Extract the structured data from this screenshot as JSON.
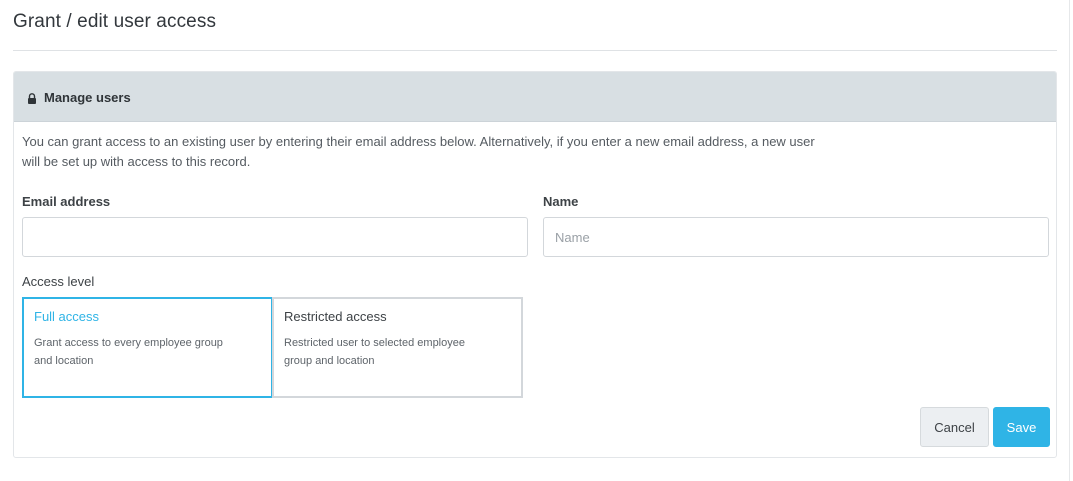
{
  "page": {
    "title": "Grant / edit user access"
  },
  "panel": {
    "header_label": "Manage users",
    "header_icon": "lock-icon",
    "intro_line1": "You can grant access to an existing user by entering their email address below. Alternatively, if you enter a new email address, a new user",
    "intro_line2": "will be set up with access to this record."
  },
  "form": {
    "email": {
      "label": "Email address",
      "value": "",
      "placeholder": ""
    },
    "name": {
      "label": "Name",
      "value": "",
      "placeholder": "Name"
    },
    "access_level": {
      "label": "Access level",
      "selected": "full",
      "options": [
        {
          "id": "full",
          "title": "Full access",
          "description_line1": "Grant access to every employee group",
          "description_line2": "and location"
        },
        {
          "id": "restricted",
          "title": "Restricted access",
          "description_line1": "Restricted user to selected employee",
          "description_line2": "group and location"
        }
      ]
    }
  },
  "actions": {
    "cancel_label": "Cancel",
    "save_label": "Save"
  },
  "colors": {
    "accent": "#2fb4e6",
    "header_bg": "#d8dfe3",
    "border": "#d3d7db"
  }
}
